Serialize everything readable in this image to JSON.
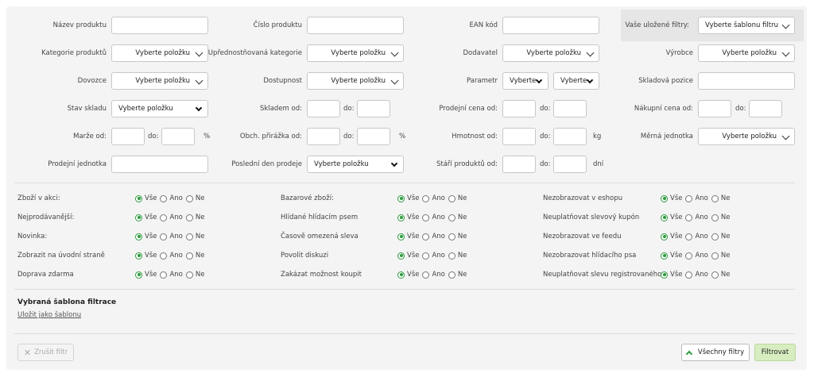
{
  "fields": {
    "product_name": "Název produktu",
    "product_number": "Číslo produktu",
    "ean": "EAN kód",
    "saved_filters": "Vaše uložené filtry:",
    "saved_filters_value": "Vyberte šablonu filtru",
    "category": "Kategorie produktů",
    "preferred_category": "Upřednostňovaná kategorie",
    "supplier": "Dodavatel",
    "manufacturer": "Výrobce",
    "importer": "Dovozce",
    "availability": "Dostupnost",
    "parameter": "Parametr",
    "warehouse_position": "Skladová pozice",
    "stock_state": "Stav skladu",
    "in_stock_from": "Skladem od:",
    "sale_price_from": "Prodejní cena od:",
    "purchase_price_from": "Nákupní cena od:",
    "margin_from": "Marže od:",
    "markup_from": "Obch. přirážka od:",
    "weight_from": "Hmotnost od:",
    "measure_unit": "Měrná jednotka",
    "sale_unit": "Prodejní jednotka",
    "last_sale_day": "Poslední den prodeje",
    "product_age_from": "Stáří produktů od:",
    "to": "do:",
    "select_item": "Vyberte položku",
    "select": "Vyberte",
    "unit_percent": "%",
    "unit_kg": "kg",
    "unit_days": "dní"
  },
  "radio_options": {
    "all": "Vše",
    "yes": "Ano",
    "no": "Ne"
  },
  "flags": {
    "col1": [
      "Zboží v akci:",
      "Nejprodávanější:",
      "Novinka:",
      "Zobrazit na úvodní straně",
      "Doprava zdarma"
    ],
    "col2": [
      "Bazarové zboží:",
      "Hlídané hlídacím psem",
      "Časově omezená sleva",
      "Povolit diskuzi",
      "Zakázat možnost koupit"
    ],
    "col3": [
      "Nezobrazovat v eshopu",
      "Neuplatňovat slevový kupón",
      "Nezobrazovat ve feedu",
      "Nezobrazovat hlídacího psa",
      "Neuplatňovat slevu registrovaného"
    ]
  },
  "template": {
    "title": "Vybraná šablona filtrace",
    "save_link": "Uložit jako šablonu"
  },
  "buttons": {
    "cancel": "Zrušit filtr",
    "all_filters": "Všechny filtry",
    "filter": "Filtrovat"
  },
  "colors": {
    "accent": "#2c9a3c",
    "filter_button": "#d7edc0"
  }
}
